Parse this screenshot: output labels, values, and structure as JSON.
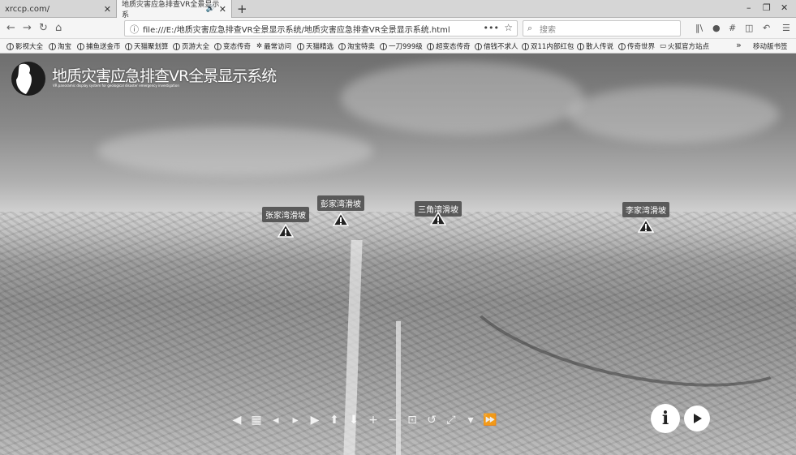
{
  "tabs": [
    {
      "label": "xrccp.com/"
    },
    {
      "label": "地质灾害应急排查VR全景显示系"
    }
  ],
  "url": "file:///E:/地质灾害应急排查VR全景显示系统/地质灾害应急排查VR全景显示系统.html",
  "search_placeholder": "搜索",
  "bookmarks": [
    "影视大全",
    "淘宝",
    "捕鱼送金币",
    "天猫聚划算",
    "页游大全",
    "变态传奇",
    "最常访问",
    "天猫精选",
    "淘宝特卖",
    "一刀999级",
    "超变态传奇",
    "借钱不求人",
    "双11内部红包",
    "散人传说",
    "传奇世界",
    "火狐官方站点"
  ],
  "bookmarks_mobile": "移动版书签",
  "app": {
    "title": "地质灾害应急排查VR全景显示系统",
    "subtitle": "VR panoramic display system for geological disaster emergency investigation"
  },
  "hotspots": [
    {
      "label": "张家湾滑坡"
    },
    {
      "label": "彭家湾滑坡"
    },
    {
      "label": "三角湾滑坡"
    },
    {
      "label": "李家湾滑坡"
    }
  ],
  "controls": [
    "arrow-left-icon",
    "grid-icon",
    "arrow-left2-icon",
    "arrow-right-icon",
    "arrow-right2-icon",
    "arrow-up-icon",
    "arrow-down-icon",
    "zoom-in-icon",
    "zoom-out-icon",
    "vr-glasses-icon",
    "rotate-icon",
    "fullscreen-icon",
    "minimize-icon",
    "fast-forward-icon"
  ],
  "info_label": "i"
}
